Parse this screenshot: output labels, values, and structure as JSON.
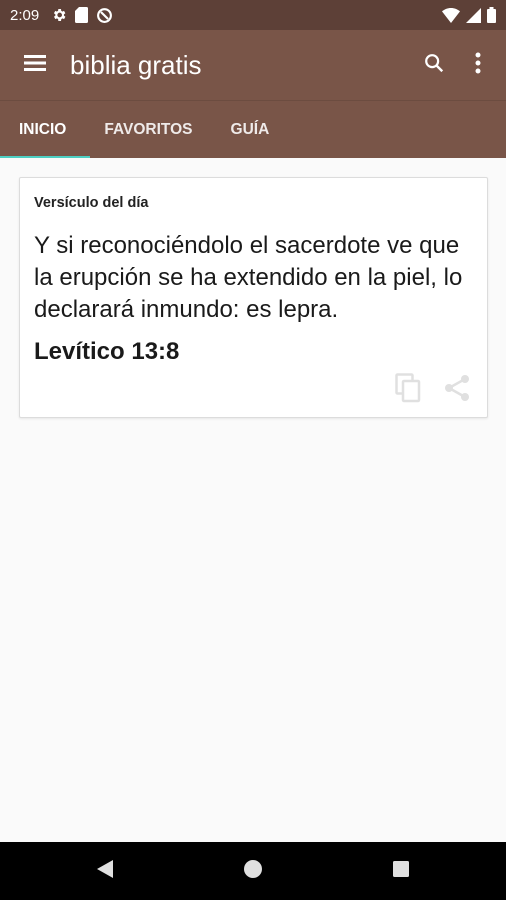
{
  "status_bar": {
    "time": "2:09",
    "left_icons": [
      "gear-icon",
      "sd-card-icon",
      "data-saver-icon"
    ],
    "right_icons": [
      "wifi-icon",
      "signal-icon",
      "battery-icon"
    ]
  },
  "app_bar": {
    "title": "biblia gratis",
    "icons": [
      "menu-icon",
      "search-icon",
      "more-vert-icon"
    ]
  },
  "tabs": [
    {
      "label": "INICIO",
      "selected": true
    },
    {
      "label": "FAVORITOS",
      "selected": false
    },
    {
      "label": "GUÍA",
      "selected": false
    }
  ],
  "verse_card": {
    "header": "Versículo del día",
    "text": "Y si reconociéndolo el sacerdote ve que la erupción se ha extendido en la piel, lo declarará inmundo: es lepra.",
    "reference": "Levítico 13:8",
    "actions": [
      "copy-icon",
      "share-icon"
    ]
  },
  "nav_bar": {
    "buttons": [
      "back-icon",
      "home-icon",
      "recents-icon"
    ]
  },
  "colors": {
    "status_bar": "#5d4037",
    "app_bar": "#795548",
    "tab_indicator": "#4dd0c3",
    "background": "#fafafa"
  }
}
